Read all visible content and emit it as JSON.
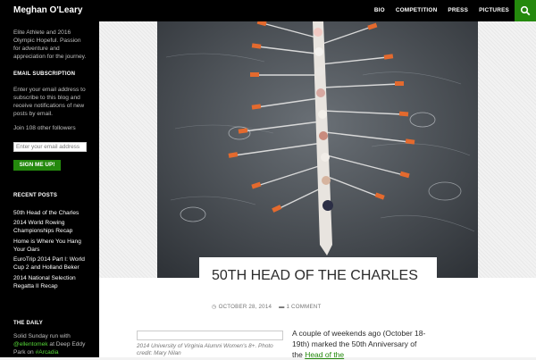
{
  "site": {
    "title": "Meghan O'Leary"
  },
  "nav": {
    "items": [
      "BIO",
      "COMPETITION",
      "PRESS",
      "PICTURES"
    ]
  },
  "sidebar": {
    "description": "Elite Athlete and 2016 Olympic Hopeful. Passion for adventure and appreciation for the journey.",
    "email_subscription": {
      "title": "EMAIL SUBSCRIPTION",
      "text": "Enter your email address to subscribe to this blog and receive notifications of new posts by email.",
      "followers": "Join 108 other followers",
      "placeholder": "Enter your email address",
      "button_label": "SIGN ME UP!"
    },
    "recent_posts": {
      "title": "RECENT POSTS",
      "items": [
        "50th Head of the Charles",
        "2014 World Rowing Championships Recap",
        "Home is Where You Hang Your Oars",
        "EuroTrip 2014 Part I: World Cup 2 and Holland Beker",
        "2014 National Selection Regatta II Recap"
      ]
    },
    "daily": {
      "title": "THE DAILY",
      "text_prefix": "Solid Sunday run with ",
      "handle": "@ellentomek",
      "text_mid": " at Deep Eddy Park on ",
      "tag": "#Arcadia"
    }
  },
  "post": {
    "title": "50TH HEAD OF THE CHARLES",
    "date": "OCTOBER 28, 2014",
    "comments": "1 COMMENT",
    "caption": "2014 University of Virginia Alumni Women's 8+. Photo credit: Mary Nilan",
    "text_prefix": "A couple of weekends ago (October 18-19th) marked the 50th Anniversary of the ",
    "text_link": "Head of the"
  },
  "colors": {
    "accent": "#24890d",
    "topbar": "#000000",
    "water": "#4a4e53",
    "oar_blade": "#e46a2e"
  }
}
